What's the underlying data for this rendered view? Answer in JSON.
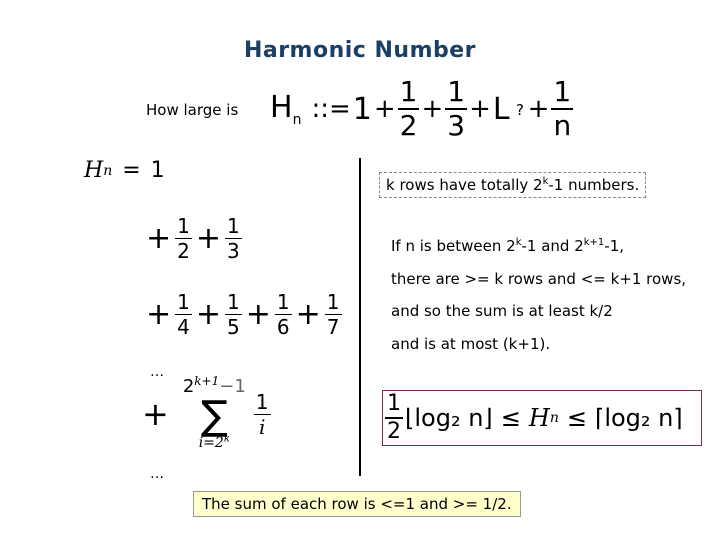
{
  "title": "Harmonic Number",
  "question": {
    "prefix": "How large is",
    "definition": {
      "lhs": "H",
      "lhs_sub": "n",
      "assign": "::=",
      "first": "1",
      "terms": [
        {
          "num": "1",
          "den": "2"
        },
        {
          "num": "1",
          "den": "3"
        }
      ],
      "ellipsis": "L",
      "last": {
        "num": "1",
        "den": "n"
      },
      "plus": "+"
    },
    "suffix": "?"
  },
  "rows": {
    "first": {
      "lhs": "H",
      "sub": "n",
      "eq": "=",
      "value": "1"
    },
    "row2": [
      {
        "num": "1",
        "den": "2"
      },
      {
        "num": "1",
        "den": "3"
      }
    ],
    "row3": [
      {
        "num": "1",
        "den": "4"
      },
      {
        "num": "1",
        "den": "5"
      },
      {
        "num": "1",
        "den": "6"
      },
      {
        "num": "1",
        "den": "7"
      }
    ],
    "dots_top": "…",
    "sum": {
      "plus": "+",
      "upper_base": "2",
      "upper_exp": "k+1",
      "upper_tail": "−1",
      "symbol": "∑",
      "lower_var": "i=2",
      "lower_exp": "k",
      "frac_num": "1",
      "frac_den": "i"
    },
    "dots_bottom": "…"
  },
  "right": {
    "note_box": {
      "pre": "k rows have totally 2",
      "sup": "k",
      "post": "-1 numbers."
    },
    "para": [
      {
        "pre": "If n is between 2",
        "sup1": "k",
        "mid": "-1 and 2",
        "sup2": "k+1",
        "post": "-1,"
      },
      {
        "text": "there are >= k rows and <= k+1 rows,"
      },
      {
        "text": "and so the sum is at least k/2"
      },
      {
        "text": "and is at most (k+1)."
      }
    ],
    "bound": {
      "coef_num": "1",
      "coef_den": "2",
      "floor_expr": "⌊log₂ n⌋",
      "le": "≤",
      "mid": "H",
      "mid_sub": "n",
      "ceil_expr": "⌈log₂ n⌉"
    }
  },
  "summary": "The sum of each row is <=1 and >= 1/2.",
  "colors": {
    "title": "#1c3f66",
    "summary_bg": "#ffffcc",
    "bound_border": "#7a2a3a"
  }
}
